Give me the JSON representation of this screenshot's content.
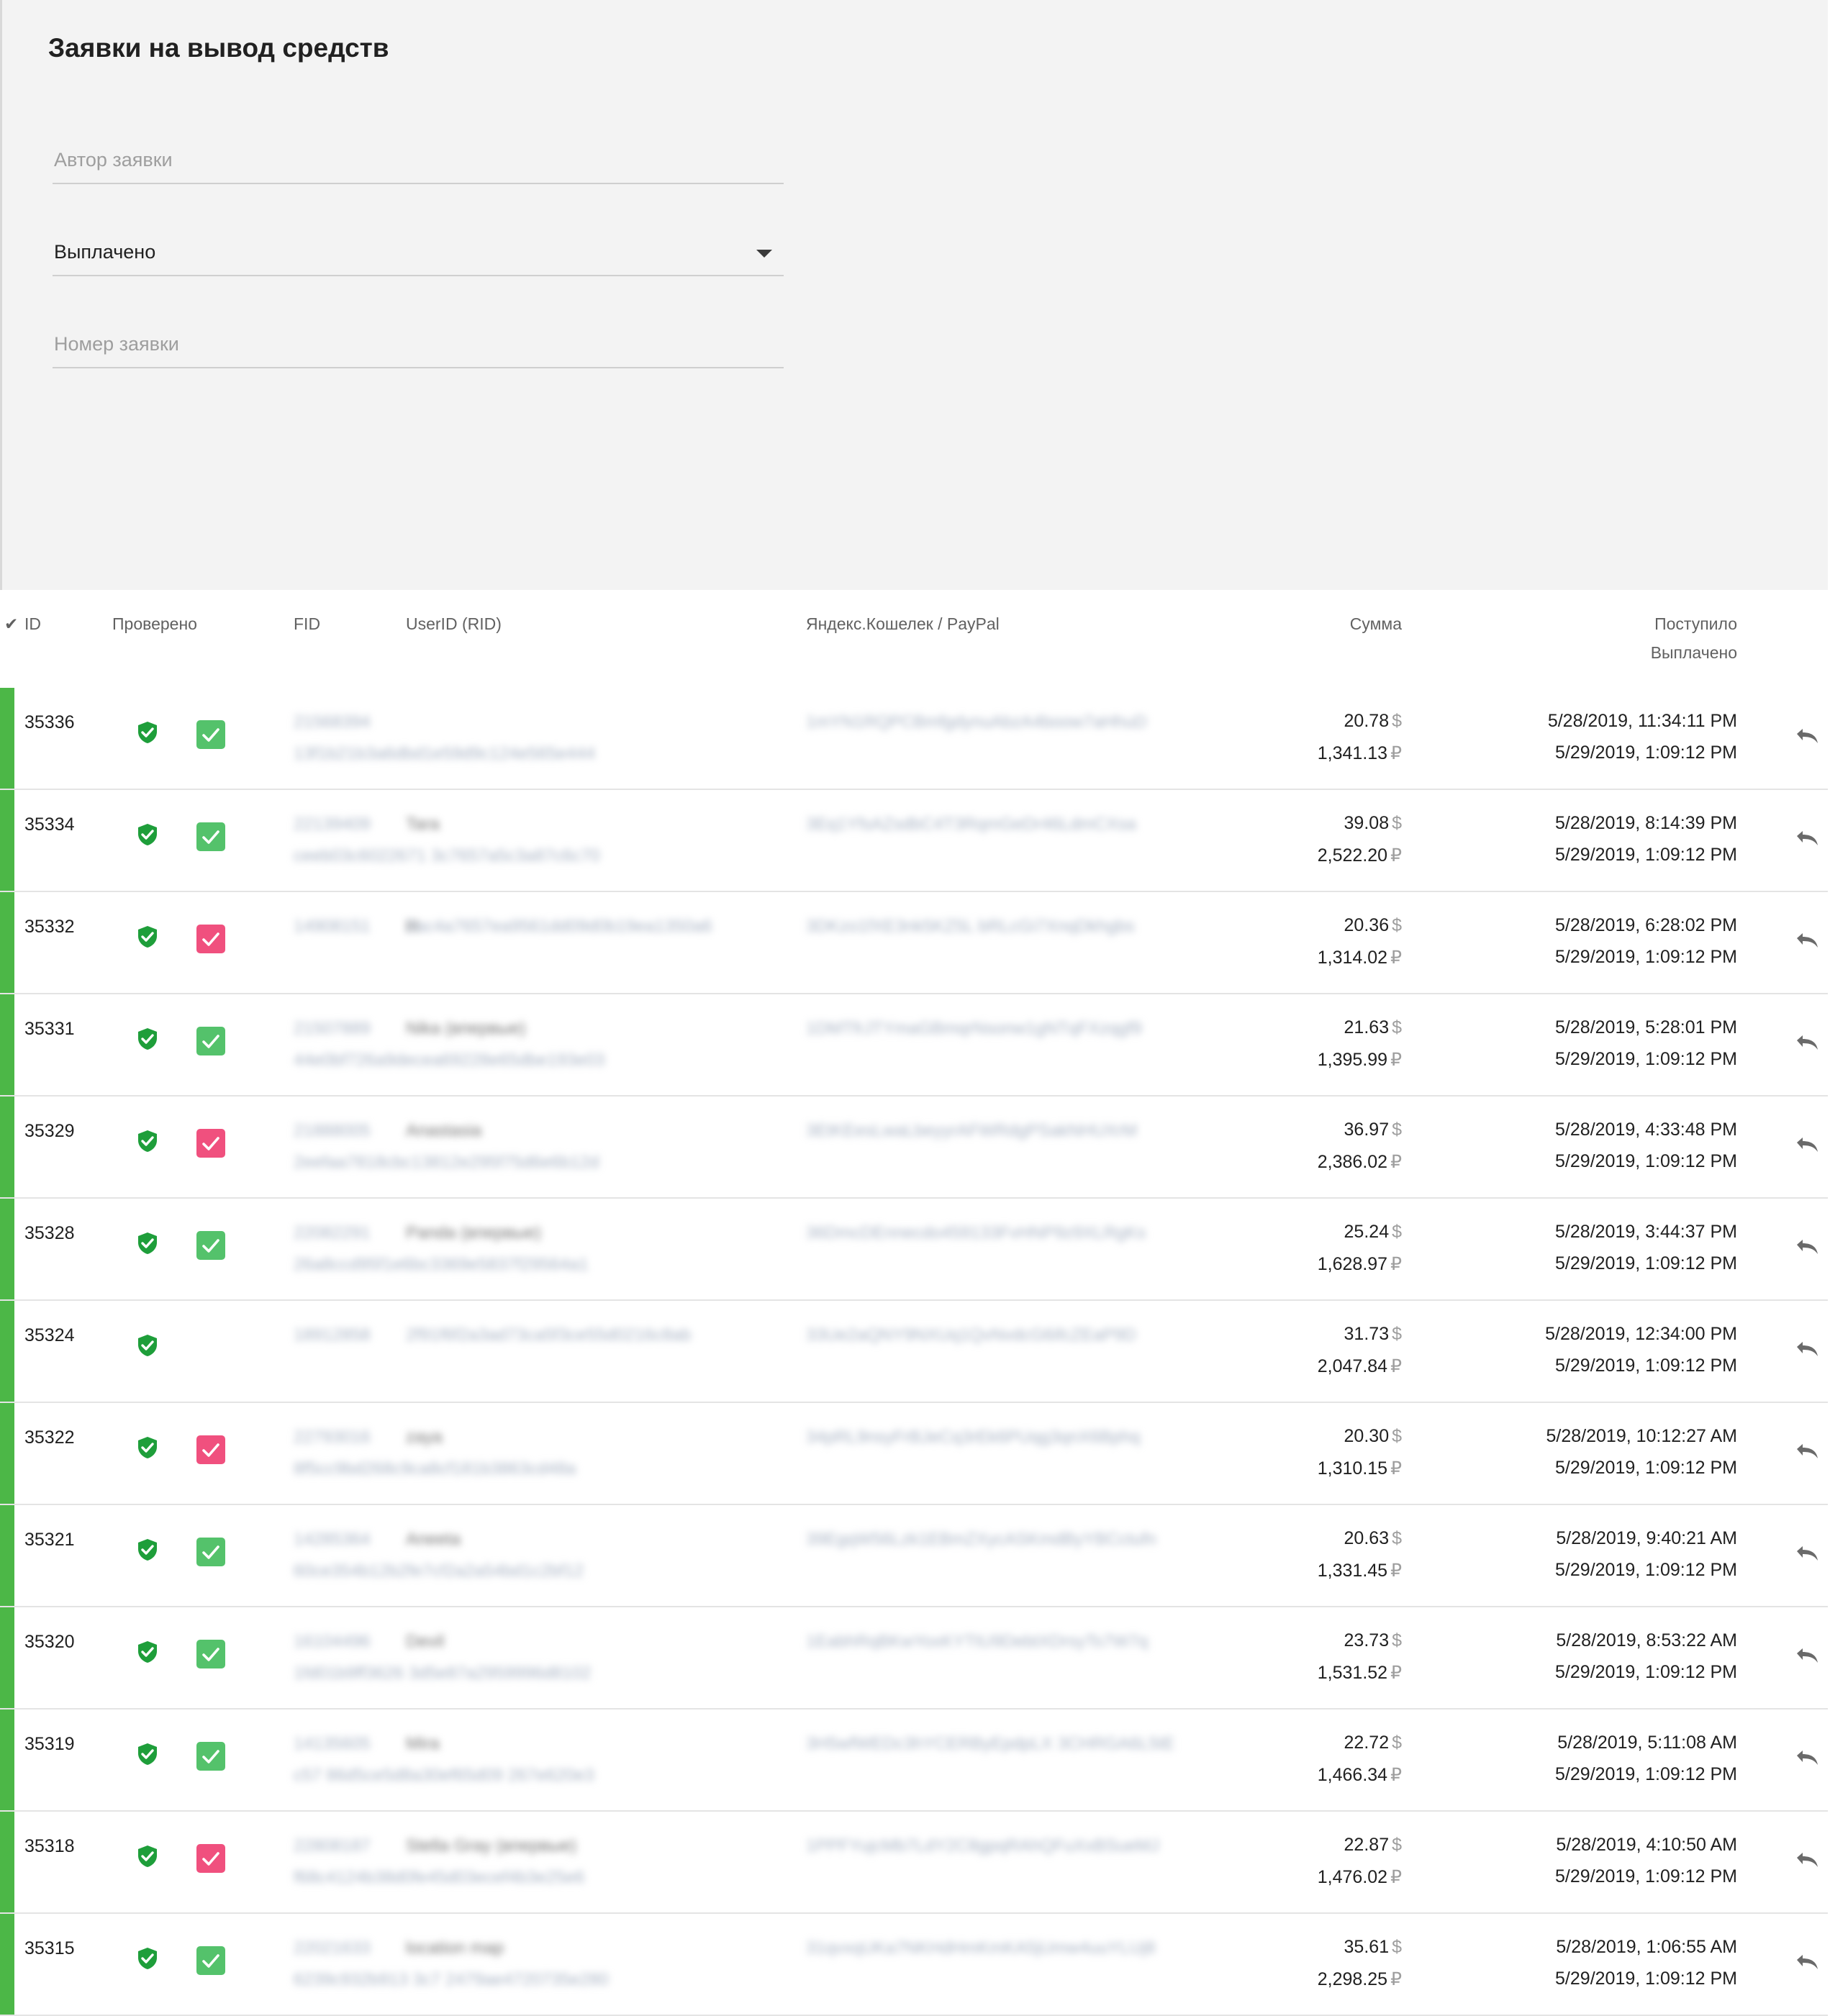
{
  "page": {
    "title": "Заявки на вывод средств"
  },
  "filters": {
    "author_placeholder": "Автор заявки",
    "status_value": "Выплачено",
    "number_placeholder": "Номер заявки"
  },
  "table": {
    "headers": {
      "check": "✔",
      "id": "ID",
      "verified": "Проверено",
      "fid": "FID",
      "userid": "UserID (RID)",
      "wallet": "Яндекс.Кошелек / PayPal",
      "sum": "Сумма",
      "received": "Поступило",
      "paid": "Выплачено"
    },
    "currency": {
      "usd": "$",
      "rub": "₽"
    },
    "rows": [
      {
        "id": "35336",
        "checked": "ok",
        "fid": "21568394",
        "name": "",
        "uid": "13f1b21b3a6dbd1e59d9c124e565e444",
        "wallet": "1mYN1RQPCBmfgdynuAbzA4boow7aHhuD",
        "usd": "20.78",
        "rub": "1,341.13",
        "received": "5/28/2019, 11:34:11 PM",
        "paid": "5/29/2019, 1:09:12 PM"
      },
      {
        "id": "35334",
        "checked": "ok",
        "fid": "22139409",
        "name": "Tara",
        "uid": "ceeb03c6022671 3c7657a5c3a87c6c70",
        "wallet": "3Eq1YfsAZsdbC4T3RqmGeDr46LdmCXsa",
        "usd": "39.08",
        "rub": "2,522.20",
        "received": "5/28/2019, 8:14:39 PM",
        "paid": "5/29/2019, 1:09:12 PM"
      },
      {
        "id": "35332",
        "checked": "bad",
        "fid": "14908151",
        "name": "H",
        "uid": "2ac4a7657ea9561dd09d0b19ea1350a6",
        "wallet": "3DKzo1fXE3nk5KZ5L bRLcGi7XnqDkhgbs",
        "usd": "20.36",
        "rub": "1,314.02",
        "received": "5/28/2019, 6:28:02 PM",
        "paid": "5/29/2019, 1:09:12 PM"
      },
      {
        "id": "35331",
        "checked": "ok",
        "fid": "21507889",
        "name": "Nika (впервые)",
        "uid": "44e0bf726a9decea69228e65dbe193e03",
        "wallet": "1DMTfrJTYmaGBmqrNsonw1gNTqFXzqgf9",
        "usd": "21.63",
        "rub": "1,395.99",
        "received": "5/28/2019, 5:28:01 PM",
        "paid": "5/29/2019, 1:09:12 PM"
      },
      {
        "id": "35329",
        "checked": "bad",
        "fid": "21888005",
        "name": "Anastasia",
        "uid": "2eefaa7818cbc13812e295f75d6e6b12d",
        "wallet": "3EtKEesLwaLbeyyrAFWRdgPSakNHUXrM",
        "usd": "36.97",
        "rub": "2,386.02",
        "received": "5/28/2019, 4:33:48 PM",
        "paid": "5/29/2019, 1:09:12 PM"
      },
      {
        "id": "35328",
        "checked": "ok",
        "fid": "22082291",
        "name": "Panda (впервые)",
        "uid": "26a8ccd95f1e6bc3369e5837f29564a1",
        "wallet": "36DmcDEnnecdo459133FvHNP9z9XLRgKs",
        "usd": "25.24",
        "rub": "1,628.97",
        "received": "5/28/2019, 3:44:37 PM",
        "paid": "5/29/2019, 1:09:12 PM"
      },
      {
        "id": "35324",
        "checked": "none",
        "fid": "18912858",
        "name": "",
        "uid": "2f91f6f2a3ad73ca5f3ce55d0216c8ab",
        "wallet": "33Ue2aQNY9NXUq1QvNvdcG6ifcZEaP9D",
        "usd": "31.73",
        "rub": "2,047.84",
        "received": "5/28/2019, 12:34:00 PM",
        "paid": "5/29/2019, 1:09:12 PM"
      },
      {
        "id": "35322",
        "checked": "bad",
        "fid": "22793016",
        "name": "zaya",
        "uid": "8f5cc9bd268c9ca8cf181b3863cd48a",
        "wallet": "34pRL9nsyFrBJeCq3rEk6PUqg3qnX6Bphq",
        "usd": "20.30",
        "rub": "1,310.15",
        "received": "5/28/2019, 10:12:27 AM",
        "paid": "5/29/2019, 1:09:12 PM"
      },
      {
        "id": "35321",
        "checked": "ok",
        "fid": "14285364",
        "name": "Aneeta",
        "uid": "60ce354b12b2fe7cf2a2a54bd1c2bf12",
        "wallet": "39EgqW56Lzk1EBmZXycASKmdByYBCctufn",
        "usd": "20.63",
        "rub": "1,331.45",
        "received": "5/28/2019, 9:40:21 AM",
        "paid": "5/29/2019, 1:09:12 PM"
      },
      {
        "id": "35320",
        "checked": "ok",
        "fid": "16104496",
        "name": "Devil",
        "uid": "1fd01b9ff3626 3d5e87a2959996d8102",
        "wallet": "1EabhRqBKwYoxKYTtU9DebtXDrsyTs7W7q",
        "usd": "23.73",
        "rub": "1,531.52",
        "received": "5/28/2019, 8:53:22 AM",
        "paid": "5/29/2019, 1:09:12 PM"
      },
      {
        "id": "35319",
        "checked": "ok",
        "fid": "14135605",
        "name": "Mira",
        "uid": "c57 86d5ce5d8a30ef65d09 267e620e3",
        "wallet": "3H5wfWEDc3hYCERByEpdpLX 3CHRGA6L5tE",
        "usd": "22.72",
        "rub": "1,466.34",
        "received": "5/28/2019, 5:11:08 AM",
        "paid": "5/29/2019, 1:09:12 PM"
      },
      {
        "id": "35318",
        "checked": "bad",
        "fid": "22808187",
        "name": "Stella Gray (впервые)",
        "uid": "f68c4124b38d0fe45d03ecef4b3e25e6",
        "wallet": "1PPFYujcMb7LdY2C8gpqRAhQFuXxBSueMJ",
        "usd": "22.87",
        "rub": "1,476.02",
        "received": "5/28/2019, 4:10:50 AM",
        "paid": "5/29/2019, 1:09:12 PM"
      },
      {
        "id": "35315",
        "checked": "ok",
        "fid": "22021633",
        "name": "location map",
        "uid": "6239c932b913 3c7 2479ae4720735e280",
        "wallet": "31qvxqUKa7NKHdHmKmKA5jUmw4uuYLUj8",
        "usd": "35.61",
        "rub": "2,298.25",
        "received": "5/28/2019, 1:06:55 AM",
        "paid": "5/29/2019, 1:09:12 PM"
      }
    ]
  },
  "colors": {
    "accent_green": "#4cb747",
    "check_ok": "#54c26b",
    "check_bad": "#f0507e",
    "shield": "#1e9e3a"
  },
  "icons": {
    "verified": "shield-check-icon",
    "undo": "undo-icon",
    "dropdown": "caret-down-icon"
  }
}
